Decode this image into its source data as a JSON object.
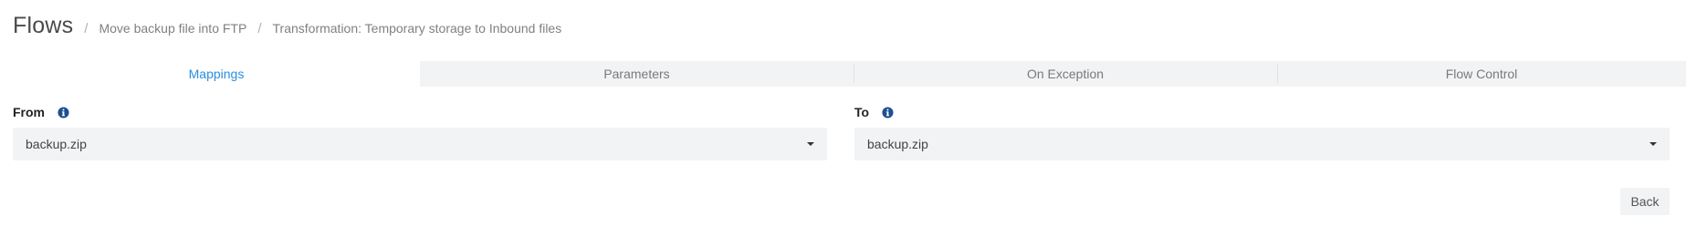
{
  "breadcrumb": {
    "root": "Flows",
    "separator": "/",
    "items": [
      "Move backup file into FTP",
      "Transformation: Temporary storage to Inbound files"
    ]
  },
  "tabs": [
    {
      "label": "Mappings",
      "active": true
    },
    {
      "label": "Parameters",
      "active": false
    },
    {
      "label": "On Exception",
      "active": false
    },
    {
      "label": "Flow Control",
      "active": false
    }
  ],
  "from": {
    "label": "From",
    "value": "backup.zip",
    "info_icon": "info-circle-icon"
  },
  "to": {
    "label": "To",
    "value": "backup.zip",
    "info_icon": "info-circle-icon"
  },
  "actions": {
    "back_label": "Back"
  },
  "colors": {
    "accent": "#2b8de0",
    "info_icon": "#1d4f91",
    "field_bg": "#f2f3f4"
  }
}
